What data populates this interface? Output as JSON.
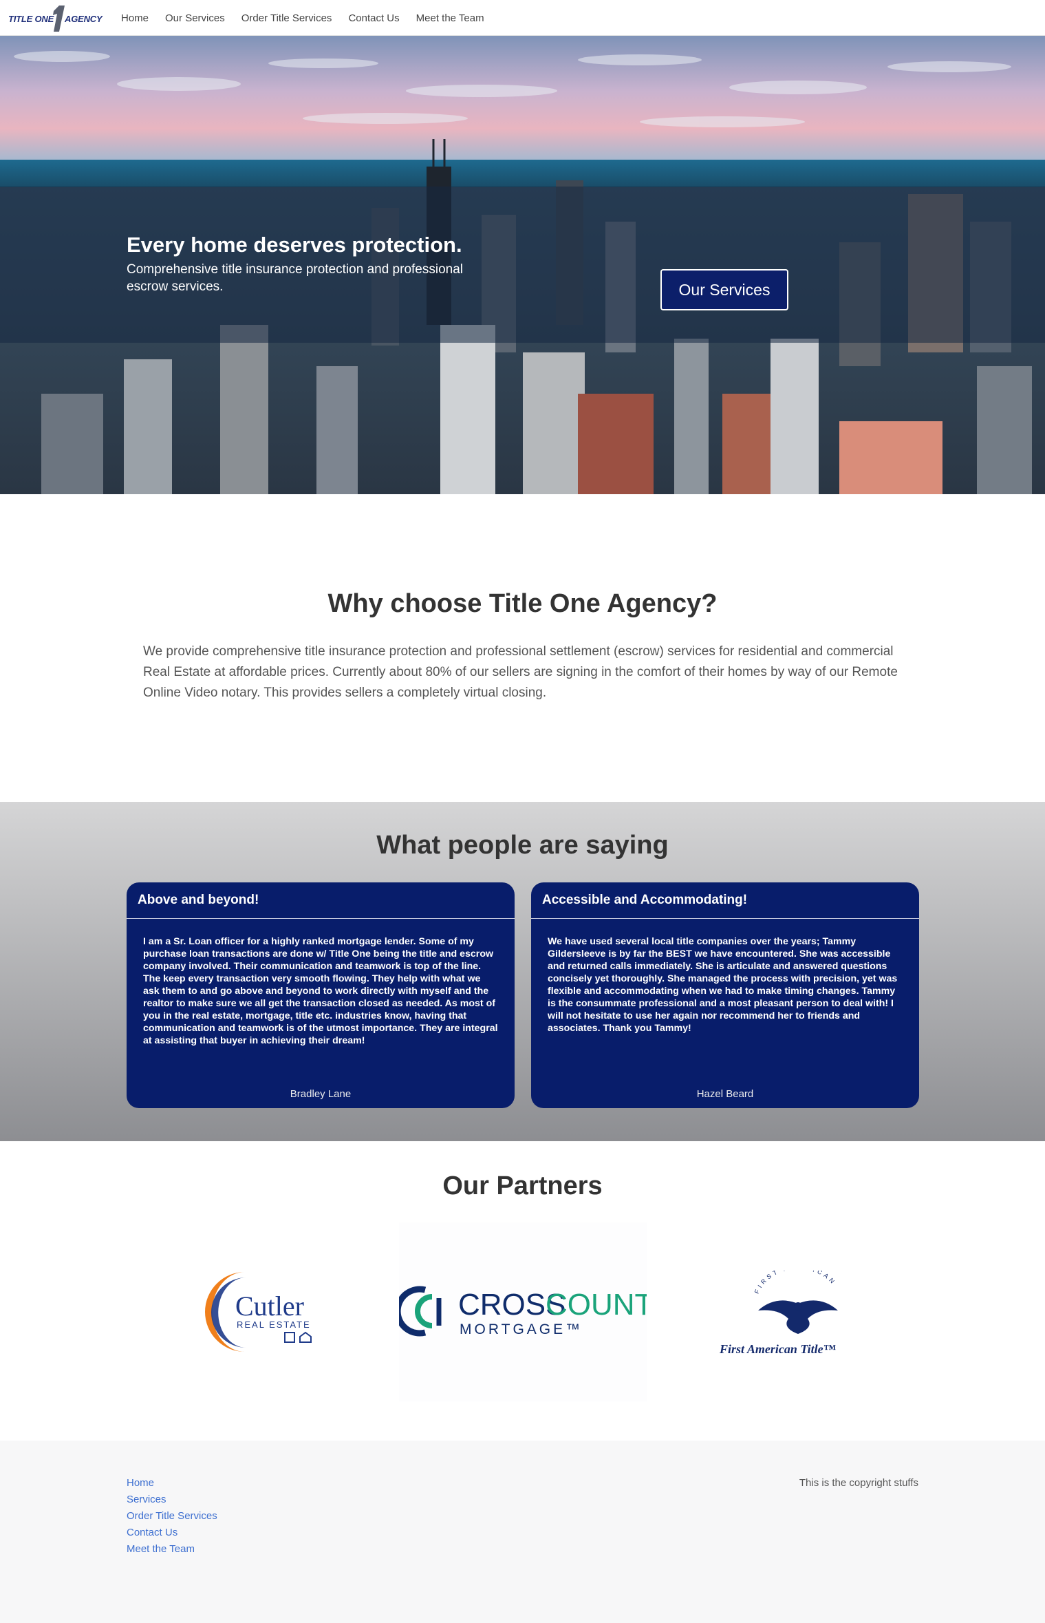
{
  "brand": {
    "logo_left": "TITLE ONE",
    "logo_right": "AGENCY",
    "logo_mark": "1",
    "primary_color": "#081d6b",
    "link_color": "#3d6fd0"
  },
  "nav": {
    "items": [
      {
        "label": "Home"
      },
      {
        "label": "Our Services"
      },
      {
        "label": "Order Title Services"
      },
      {
        "label": "Contact Us"
      },
      {
        "label": "Meet the Team"
      }
    ]
  },
  "hero": {
    "title": "Every home deserves protection.",
    "subtitle": "Comprehensive title insurance protection and professional escrow services.",
    "button_label": "Our Services"
  },
  "why": {
    "title": "Why choose Title One Agency?",
    "text": "We provide comprehensive title insurance protection and professional settlement (escrow) services for residential and commercial Real Estate at affordable prices. Currently about 80% of our sellers are signing in the comfort of their homes by way of our Remote Online Video notary. This provides sellers a completely virtual closing."
  },
  "testimonials": {
    "title": "What people are saying",
    "items": [
      {
        "heading": "Above and beyond!",
        "body": "I am a Sr. Loan officer for a highly ranked mortgage lender. Some of my purchase loan transactions are done w/ Title One being the title and escrow company involved. Their communication and teamwork is top of the line. The keep every transaction very smooth flowing. They help with what we ask them to and go above and beyond to work directly with myself and the realtor to make sure we all get the transaction closed as needed. As most of you in the real estate, mortgage, title etc. industries know, having that communication and teamwork is of the utmost importance. They are integral at assisting that buyer in achieving their dream!",
        "author": "Bradley Lane"
      },
      {
        "heading": "Accessible and Accommodating!",
        "body": "We have used several local title companies over the years; Tammy Gildersleeve is by far the BEST we have encountered. She was accessible and returned calls immediately. She is articulate and answered questions concisely yet thoroughly. She managed the process with precision, yet was flexible and accommodating when we had to make timing changes. Tammy is the consummate professional and a most pleasant person to deal with! I will not hesitate to use her again nor recommend her to friends and associates. Thank you Tammy!",
        "author": "Hazel Beard"
      }
    ]
  },
  "partners": {
    "title": "Our Partners",
    "items": [
      {
        "name": "Cutler",
        "tagline": "REAL ESTATE",
        "icon": "cutler-logo"
      },
      {
        "name_left": "CROSS",
        "name_right": "COUNTRY",
        "tagline": "MORTGAGE™",
        "icon": "crosscountry-logo"
      },
      {
        "arc_text": "FIRST AMERICAN",
        "name": "First American Title™",
        "icon": "eagle-logo"
      }
    ]
  },
  "footer": {
    "links": [
      {
        "label": "Home"
      },
      {
        "label": "Services"
      },
      {
        "label": "Order Title Services"
      },
      {
        "label": "Contact Us"
      },
      {
        "label": "Meet the Team"
      }
    ],
    "copyright": "This is the copyright stuffs"
  }
}
